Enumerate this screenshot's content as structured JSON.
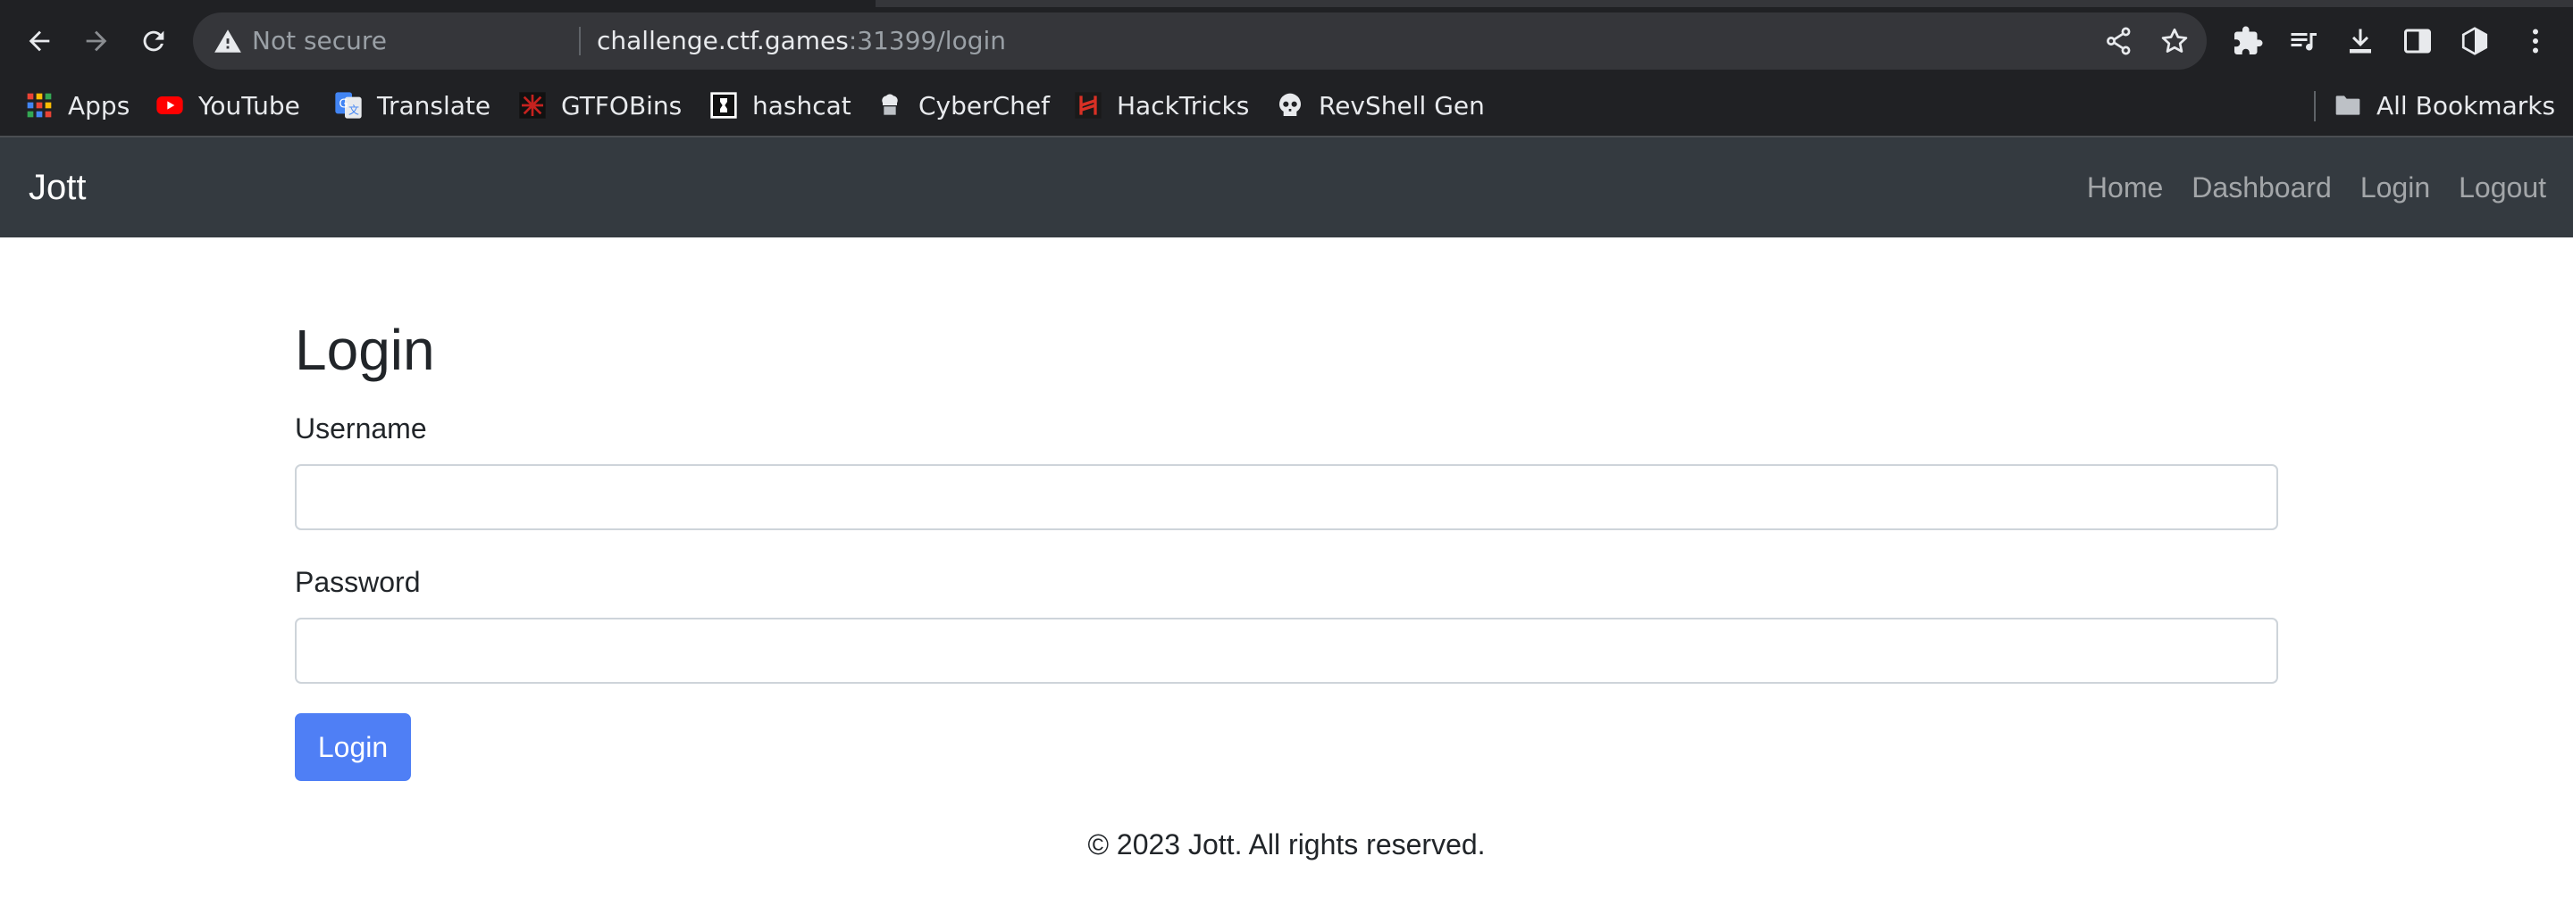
{
  "browser": {
    "omnibox": {
      "security_label": "Not secure",
      "url_host": "challenge.ctf.games",
      "url_rest": ":31399/login"
    },
    "bookmarks": [
      {
        "label": "Apps",
        "icon": "apps-grid-icon"
      },
      {
        "label": "YouTube",
        "icon": "youtube-icon"
      },
      {
        "label": "Translate",
        "icon": "google-translate-icon"
      },
      {
        "label": "GTFOBins",
        "icon": "gtfobins-icon"
      },
      {
        "label": "hashcat",
        "icon": "hashcat-icon"
      },
      {
        "label": "CyberChef",
        "icon": "cyberchef-icon"
      },
      {
        "label": "HackTricks",
        "icon": "hacktricks-icon"
      },
      {
        "label": "RevShell Gen",
        "icon": "skull-icon"
      }
    ],
    "all_bookmarks_label": "All Bookmarks"
  },
  "navbar": {
    "brand": "Jott",
    "links": [
      "Home",
      "Dashboard",
      "Login",
      "Logout"
    ]
  },
  "login_form": {
    "title": "Login",
    "username_label": "Username",
    "username_value": "",
    "password_label": "Password",
    "password_value": "",
    "submit_label": "Login"
  },
  "footer": {
    "text": "© 2023 Jott. All rights reserved."
  },
  "colors": {
    "navbar_bg": "#343a40",
    "button_bg": "#4f7ff5",
    "chrome_bg": "#202124",
    "omnibox_bg": "#35363a"
  }
}
